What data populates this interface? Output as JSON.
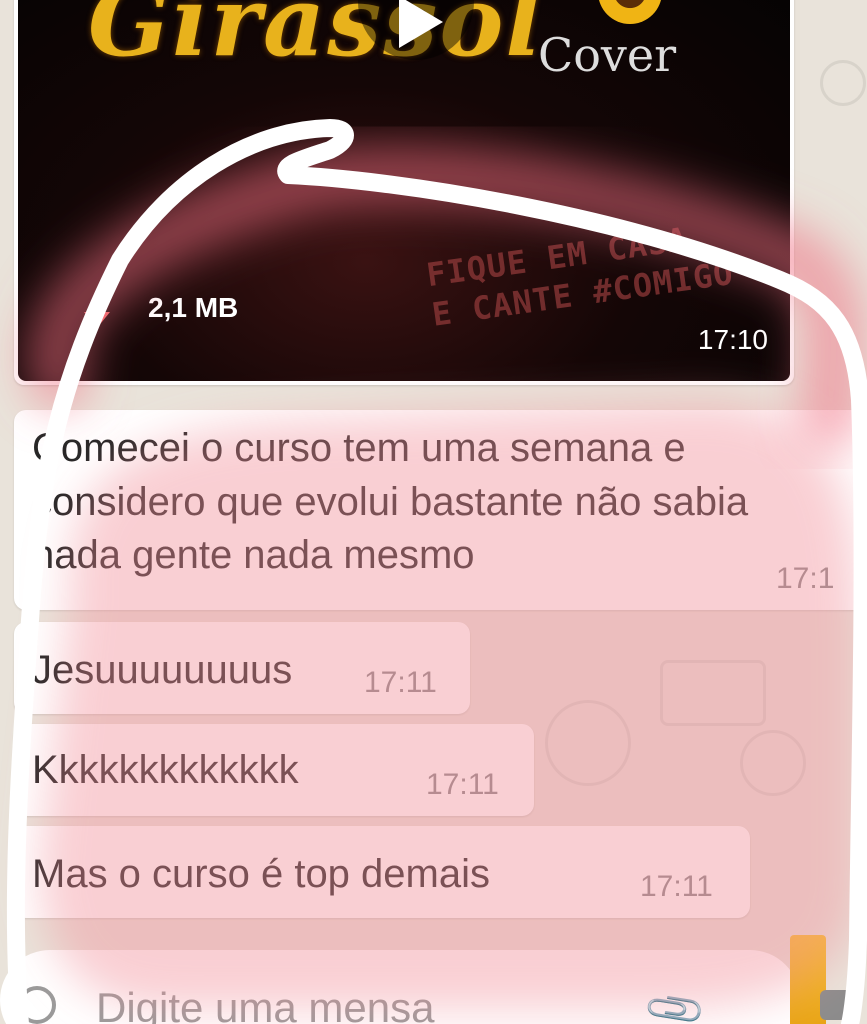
{
  "video_message": {
    "title_art": "Girassol",
    "cover_text": "Cover",
    "stamp_line1": "FIQUE EM CASA",
    "stamp_line2": "E CANTE #COMIGO",
    "file_size": "2,1 MB",
    "time": "17:10",
    "download_icon": "download-arrow-icon",
    "play_icon": "play-icon"
  },
  "messages": [
    {
      "text": "Comecei o curso tem uma semana e considero que evolui bastante não sabia nada gente nada mesmo",
      "time": "17:1"
    },
    {
      "text": "Jesuuuuuuuus",
      "time": "17:11"
    },
    {
      "text": "Kkkkkkkkkkkkk",
      "time": "17:11"
    },
    {
      "text": "Mas o curso é top demais",
      "time": "17:11"
    }
  ],
  "input": {
    "placeholder": "Digite uma mensa",
    "emoji_icon": "emoji-icon",
    "attach_icon": "paperclip-icon",
    "camera_icon": "camera-icon"
  },
  "colors": {
    "highlight": "#f0a0a8",
    "scribble": "#ffffff",
    "bubble": "#ffffff",
    "wallpaper": "#e9e3da"
  }
}
